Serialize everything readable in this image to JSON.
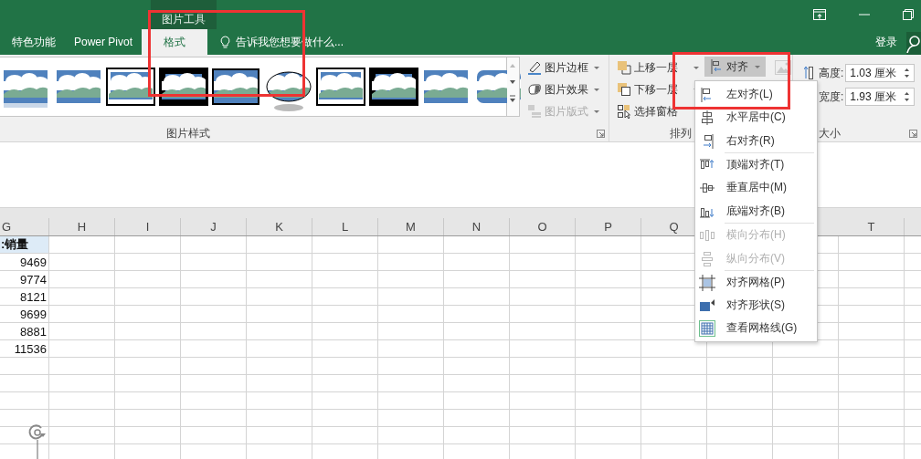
{
  "window": {
    "context_tab_group": "图片工具",
    "sign_in": "登录"
  },
  "tabs": [
    {
      "label": "特色功能",
      "selected": false
    },
    {
      "label": "Power Pivot",
      "selected": false
    },
    {
      "label": "格式",
      "selected": true
    }
  ],
  "tell_me": {
    "placeholder": "告诉我您想要做什么..."
  },
  "ribbon": {
    "picture_styles": {
      "label": "图片样式",
      "styles": [
        {
          "kind": "reflect"
        },
        {
          "kind": "soft"
        },
        {
          "kind": "double"
        },
        {
          "kind": "thick"
        },
        {
          "kind": "frame"
        },
        {
          "kind": "oval"
        },
        {
          "kind": "double"
        },
        {
          "kind": "thick"
        },
        {
          "kind": "soft"
        },
        {
          "kind": "rounded"
        }
      ],
      "commands": [
        {
          "kind": "border",
          "label": "图片边框",
          "disabled": false
        },
        {
          "kind": "effects",
          "label": "图片效果",
          "disabled": false
        },
        {
          "kind": "layout",
          "label": "图片版式",
          "disabled": true
        }
      ]
    },
    "arrange": {
      "label": "排列",
      "commands": [
        {
          "kind": "forward",
          "label": "上移一层"
        },
        {
          "kind": "backward",
          "label": "下移一层"
        },
        {
          "kind": "pane",
          "label": "选择窗格"
        }
      ],
      "align": {
        "label": "对齐",
        "pressed": true
      }
    },
    "size": {
      "label": "大小",
      "fields": [
        {
          "label": "高度:",
          "value": "1.03 厘米"
        },
        {
          "label": "宽度:",
          "value": "1.93 厘米"
        }
      ]
    }
  },
  "align_menu": [
    {
      "kind": "align-left",
      "label": "左对齐(L)",
      "disabled": false
    },
    {
      "kind": "align-center",
      "label": "水平居中(C)",
      "disabled": false
    },
    {
      "kind": "align-right",
      "label": "右对齐(R)",
      "disabled": false,
      "separator_after": true
    },
    {
      "kind": "align-top",
      "label": "顶端对齐(T)",
      "disabled": false
    },
    {
      "kind": "align-middle",
      "label": "垂直居中(M)",
      "disabled": false
    },
    {
      "kind": "align-bottom",
      "label": "底端对齐(B)",
      "disabled": false,
      "separator_after": true
    },
    {
      "kind": "distribute-h",
      "label": "横向分布(H)",
      "disabled": true
    },
    {
      "kind": "distribute-v",
      "label": "纵向分布(V)",
      "disabled": true,
      "separator_after": true
    },
    {
      "kind": "snap-grid",
      "label": "对齐网格(P)",
      "disabled": false
    },
    {
      "kind": "snap-shape",
      "label": "对齐形状(S)",
      "disabled": false
    },
    {
      "kind": "gridlines",
      "label": "查看网格线(G)",
      "disabled": false
    }
  ],
  "sheet": {
    "columns": [
      {
        "label": "G"
      },
      {
        "label": "H"
      },
      {
        "label": "I"
      },
      {
        "label": "J"
      },
      {
        "label": "K"
      },
      {
        "label": "L"
      },
      {
        "label": "M"
      },
      {
        "label": "N"
      },
      {
        "label": "O"
      },
      {
        "label": "P"
      },
      {
        "label": "Q"
      },
      {
        "label": "T",
        "covered_before": true
      }
    ],
    "column_g": [
      {
        "kind": "header",
        "value": ":销量"
      },
      {
        "kind": "number",
        "value": "9469"
      },
      {
        "kind": "number",
        "value": "9774"
      },
      {
        "kind": "number",
        "value": "8121"
      },
      {
        "kind": "number",
        "value": "9699"
      },
      {
        "kind": "number",
        "value": "8881"
      },
      {
        "kind": "number",
        "value": "11536"
      }
    ]
  }
}
